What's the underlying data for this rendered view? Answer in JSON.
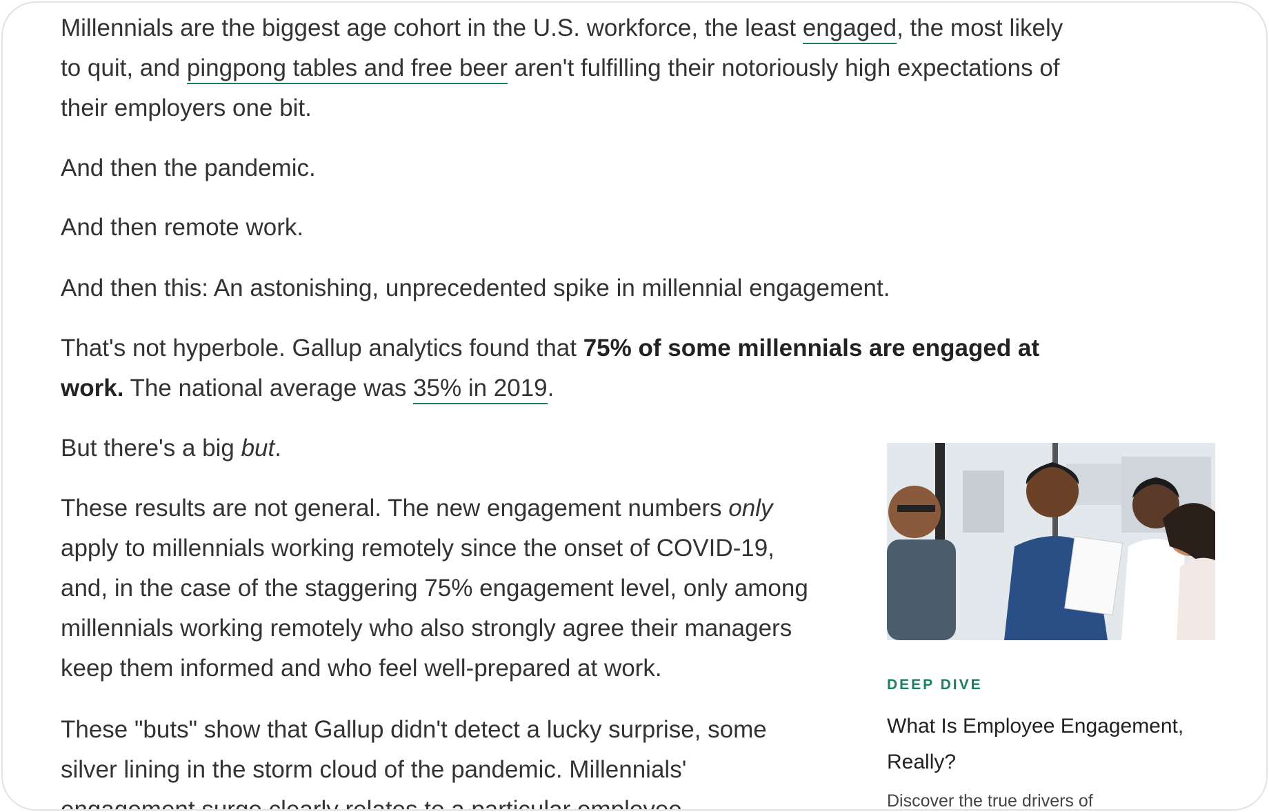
{
  "article": {
    "p1": {
      "t1": "Millennials are the biggest age cohort in the U.S. workforce, the least ",
      "link1": "engaged",
      "t2": ", the most likely to quit, and ",
      "link2": "pingpong tables and free beer",
      "t3": " aren't fulfilling their notoriously high expectations of their employers one bit."
    },
    "p2": "And then the pandemic.",
    "p3": "And then remote work.",
    "p4": "And then this: An astonishing, unprecedented spike in millennial engagement.",
    "p5": {
      "t1": "That's not hyperbole. Gallup analytics found that ",
      "bold": "75% of some millennials are engaged at work.",
      "t2": " The national average was ",
      "link": "35% in 2019",
      "t3": "."
    },
    "p6": {
      "t1": "But there's a big ",
      "em": "but",
      "t2": "."
    },
    "p7": {
      "t1": "These results are not general. The new engagement numbers ",
      "em": "only",
      "t2": " apply to millennials working remotely since the onset of COVID-19, and, in the case of the staggering 75% engagement level, only among millennials working remotely who also strongly agree their managers keep them informed and who feel well-prepared at work."
    },
    "p8": "These \"buts\" show that Gallup didn't detect a lucky surprise, some silver lining in the storm cloud of the pandemic. Millennials' engagement surge clearly relates to a particular employee"
  },
  "deep_dive": {
    "label": "DEEP DIVE",
    "title": "What Is Employee Engagement, Really?",
    "description": "Discover the true drivers of"
  },
  "colors": {
    "accent": "#1a7f5c",
    "text": "#333333"
  }
}
